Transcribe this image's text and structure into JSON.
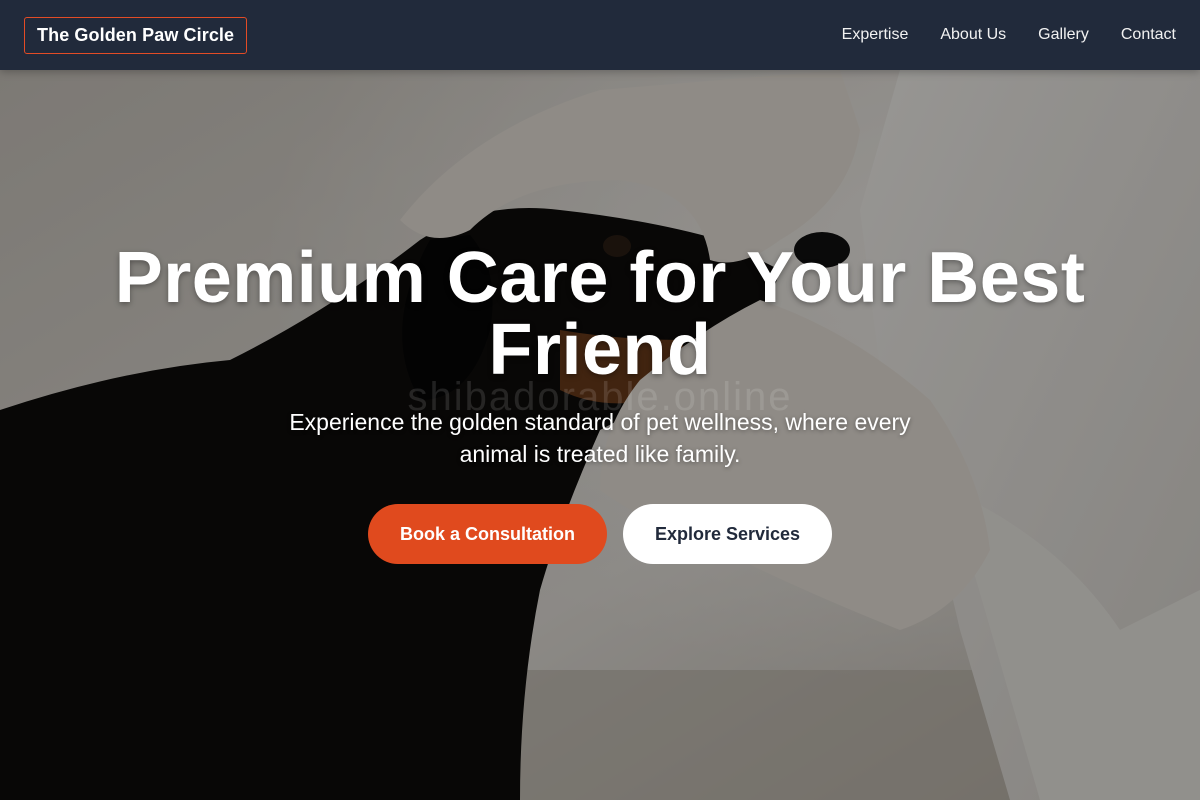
{
  "header": {
    "logo": "The Golden Paw Circle",
    "nav": [
      {
        "label": "Expertise"
      },
      {
        "label": "About Us"
      },
      {
        "label": "Gallery"
      },
      {
        "label": "Contact"
      }
    ]
  },
  "hero": {
    "title": "Premium Care for Your Best Friend",
    "subtitle": "Experience the golden standard of pet wellness, where every animal is treated like family.",
    "watermark": "shibadorable.online",
    "primary_button": "Book a Consultation",
    "secondary_button": "Explore Services"
  },
  "colors": {
    "nav_background": "#212a3b",
    "accent": "#e04a1e",
    "logo_border": "#e34c26",
    "secondary_button_bg": "#ffffff",
    "secondary_button_text": "#212a3b"
  }
}
